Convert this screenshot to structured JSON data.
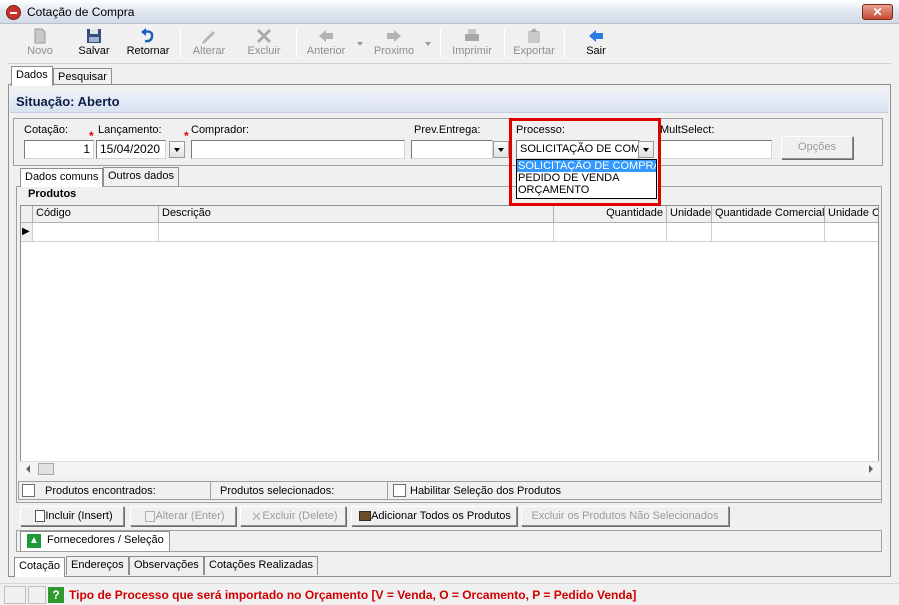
{
  "window": {
    "title": "Cotação de Compra",
    "close_glyph": "✕"
  },
  "toolbar": {
    "novo": "Novo",
    "salvar": "Salvar",
    "retornar": "Retornar",
    "alterar": "Alterar",
    "excluir": "Excluir",
    "anterior": "Anterior",
    "proximo": "Proximo",
    "imprimir": "Imprimir",
    "exportar": "Exportar",
    "sair": "Sair"
  },
  "tabs_top": [
    "Dados",
    "Pesquisar"
  ],
  "situacao": "Situação: Aberto",
  "form": {
    "cotacao_label": "Cotação:",
    "cotacao_value": "1",
    "lancamento_label": "Lançamento:",
    "lancamento_value": "15/04/2020",
    "comprador_label": "Comprador:",
    "comprador_value": "",
    "prev_entrega_label": "Prev.Entrega:",
    "prev_entrega_value": "",
    "processo_label": "Processo:",
    "processo_value": "SOLICITAÇÃO DE COM",
    "multselect_label": "MultSelect:",
    "multselect_value": "",
    "opcoes_button": "Opções",
    "required_mark": "*"
  },
  "processo_options": [
    {
      "label": "SOLICITAÇÃO DE COMPRA",
      "selected": true
    },
    {
      "label": "PEDIDO DE VENDA",
      "selected": false
    },
    {
      "label": "ORÇAMENTO",
      "selected": false
    }
  ],
  "subtabs": [
    "Dados comuns",
    "Outros dados"
  ],
  "produtos": {
    "title": "Produtos",
    "columns": [
      "Código",
      "Descrição",
      "Quantidade",
      "Unidade",
      "Quantidade Comercial",
      "Unidade Co"
    ],
    "row_marker": "▶"
  },
  "footer_info": {
    "encontrados": "Produtos encontrados:",
    "selecionados": "Produtos selecionados:",
    "habilitar": "Habilitar Seleção dos Produtos"
  },
  "actions": {
    "incluir": "Incluir (Insert)",
    "alterar": "Alterar (Enter)",
    "excluir": "Excluir (Delete)",
    "adicionar": "Adicionar Todos os Produtos",
    "excluir_nao_sel": "Excluir os Produtos Não Selecionados"
  },
  "fornecedores_tab": "Fornecedores / Seleção",
  "tabs_bottom": [
    "Cotação",
    "Endereços",
    "Observações",
    "Cotações Realizadas"
  ],
  "status": {
    "hint_icon": "?",
    "text": "Tipo de Processo que será importado no Orçamento [V = Venda, O = Orcamento, P = Pedido Venda]"
  },
  "colors": {
    "highlight": "#e00000",
    "status_text": "#d00000",
    "selection": "#3399ff",
    "header_text": "#0c1f46"
  }
}
